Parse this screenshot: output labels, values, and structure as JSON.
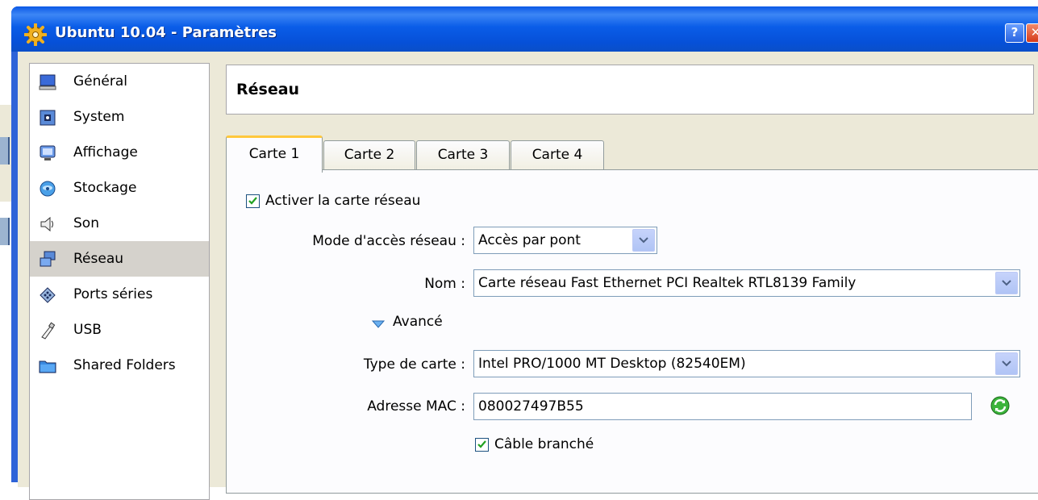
{
  "window": {
    "title": "Ubuntu 10.04 - Paramètres",
    "help_label": "?",
    "close_label": "✕"
  },
  "nav": {
    "items": [
      {
        "label": "Général",
        "icon": "monitor-icon"
      },
      {
        "label": "System",
        "icon": "chip-icon"
      },
      {
        "label": "Affichage",
        "icon": "display-icon"
      },
      {
        "label": "Stockage",
        "icon": "disk-icon"
      },
      {
        "label": "Son",
        "icon": "speaker-icon"
      },
      {
        "label": "Réseau",
        "icon": "network-icon",
        "selected": true
      },
      {
        "label": "Ports séries",
        "icon": "serial-port-icon"
      },
      {
        "label": "USB",
        "icon": "usb-icon"
      },
      {
        "label": "Shared Folders",
        "icon": "folder-icon"
      }
    ]
  },
  "page": {
    "title": "Réseau"
  },
  "tabs": [
    "Carte 1",
    "Carte 2",
    "Carte 3",
    "Carte 4"
  ],
  "adapter": {
    "enable_label": "Activer la carte réseau",
    "enabled": true,
    "mode_label": "Mode d'accès réseau :",
    "mode_value": "Accès par pont",
    "name_label": "Nom :",
    "name_value": "Carte réseau Fast Ethernet PCI Realtek RTL8139 Family",
    "advanced_label": "Avancé",
    "type_label": "Type de carte :",
    "type_value": "Intel PRO/1000 MT Desktop (82540EM)",
    "mac_label": "Adresse MAC :",
    "mac_value": "080027497B55",
    "cable_label": "Câble branché",
    "cable_connected": true
  },
  "colors": {
    "titlebar": "#0a5de8",
    "selected_nav": "#d5d2cc",
    "active_tab_accent": "#ffc83c"
  }
}
